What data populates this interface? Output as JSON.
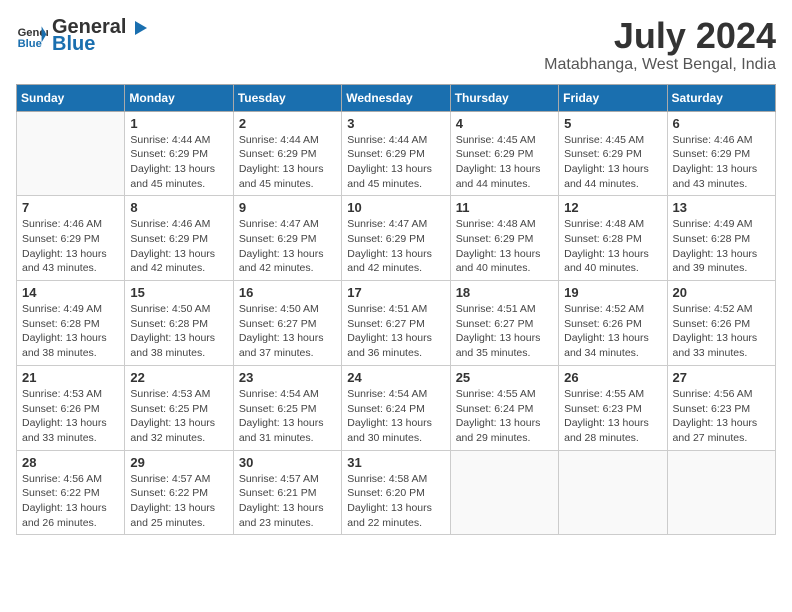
{
  "logo": {
    "text_general": "General",
    "text_blue": "Blue"
  },
  "title": "July 2024",
  "subtitle": "Matabhanga, West Bengal, India",
  "headers": [
    "Sunday",
    "Monday",
    "Tuesday",
    "Wednesday",
    "Thursday",
    "Friday",
    "Saturday"
  ],
  "weeks": [
    [
      {
        "day": "",
        "info": ""
      },
      {
        "day": "1",
        "info": "Sunrise: 4:44 AM\nSunset: 6:29 PM\nDaylight: 13 hours\nand 45 minutes."
      },
      {
        "day": "2",
        "info": "Sunrise: 4:44 AM\nSunset: 6:29 PM\nDaylight: 13 hours\nand 45 minutes."
      },
      {
        "day": "3",
        "info": "Sunrise: 4:44 AM\nSunset: 6:29 PM\nDaylight: 13 hours\nand 45 minutes."
      },
      {
        "day": "4",
        "info": "Sunrise: 4:45 AM\nSunset: 6:29 PM\nDaylight: 13 hours\nand 44 minutes."
      },
      {
        "day": "5",
        "info": "Sunrise: 4:45 AM\nSunset: 6:29 PM\nDaylight: 13 hours\nand 44 minutes."
      },
      {
        "day": "6",
        "info": "Sunrise: 4:46 AM\nSunset: 6:29 PM\nDaylight: 13 hours\nand 43 minutes."
      }
    ],
    [
      {
        "day": "7",
        "info": "Sunrise: 4:46 AM\nSunset: 6:29 PM\nDaylight: 13 hours\nand 43 minutes."
      },
      {
        "day": "8",
        "info": "Sunrise: 4:46 AM\nSunset: 6:29 PM\nDaylight: 13 hours\nand 42 minutes."
      },
      {
        "day": "9",
        "info": "Sunrise: 4:47 AM\nSunset: 6:29 PM\nDaylight: 13 hours\nand 42 minutes."
      },
      {
        "day": "10",
        "info": "Sunrise: 4:47 AM\nSunset: 6:29 PM\nDaylight: 13 hours\nand 42 minutes."
      },
      {
        "day": "11",
        "info": "Sunrise: 4:48 AM\nSunset: 6:29 PM\nDaylight: 13 hours\nand 40 minutes."
      },
      {
        "day": "12",
        "info": "Sunrise: 4:48 AM\nSunset: 6:28 PM\nDaylight: 13 hours\nand 40 minutes."
      },
      {
        "day": "13",
        "info": "Sunrise: 4:49 AM\nSunset: 6:28 PM\nDaylight: 13 hours\nand 39 minutes."
      }
    ],
    [
      {
        "day": "14",
        "info": "Sunrise: 4:49 AM\nSunset: 6:28 PM\nDaylight: 13 hours\nand 38 minutes."
      },
      {
        "day": "15",
        "info": "Sunrise: 4:50 AM\nSunset: 6:28 PM\nDaylight: 13 hours\nand 38 minutes."
      },
      {
        "day": "16",
        "info": "Sunrise: 4:50 AM\nSunset: 6:27 PM\nDaylight: 13 hours\nand 37 minutes."
      },
      {
        "day": "17",
        "info": "Sunrise: 4:51 AM\nSunset: 6:27 PM\nDaylight: 13 hours\nand 36 minutes."
      },
      {
        "day": "18",
        "info": "Sunrise: 4:51 AM\nSunset: 6:27 PM\nDaylight: 13 hours\nand 35 minutes."
      },
      {
        "day": "19",
        "info": "Sunrise: 4:52 AM\nSunset: 6:26 PM\nDaylight: 13 hours\nand 34 minutes."
      },
      {
        "day": "20",
        "info": "Sunrise: 4:52 AM\nSunset: 6:26 PM\nDaylight: 13 hours\nand 33 minutes."
      }
    ],
    [
      {
        "day": "21",
        "info": "Sunrise: 4:53 AM\nSunset: 6:26 PM\nDaylight: 13 hours\nand 33 minutes."
      },
      {
        "day": "22",
        "info": "Sunrise: 4:53 AM\nSunset: 6:25 PM\nDaylight: 13 hours\nand 32 minutes."
      },
      {
        "day": "23",
        "info": "Sunrise: 4:54 AM\nSunset: 6:25 PM\nDaylight: 13 hours\nand 31 minutes."
      },
      {
        "day": "24",
        "info": "Sunrise: 4:54 AM\nSunset: 6:24 PM\nDaylight: 13 hours\nand 30 minutes."
      },
      {
        "day": "25",
        "info": "Sunrise: 4:55 AM\nSunset: 6:24 PM\nDaylight: 13 hours\nand 29 minutes."
      },
      {
        "day": "26",
        "info": "Sunrise: 4:55 AM\nSunset: 6:23 PM\nDaylight: 13 hours\nand 28 minutes."
      },
      {
        "day": "27",
        "info": "Sunrise: 4:56 AM\nSunset: 6:23 PM\nDaylight: 13 hours\nand 27 minutes."
      }
    ],
    [
      {
        "day": "28",
        "info": "Sunrise: 4:56 AM\nSunset: 6:22 PM\nDaylight: 13 hours\nand 26 minutes."
      },
      {
        "day": "29",
        "info": "Sunrise: 4:57 AM\nSunset: 6:22 PM\nDaylight: 13 hours\nand 25 minutes."
      },
      {
        "day": "30",
        "info": "Sunrise: 4:57 AM\nSunset: 6:21 PM\nDaylight: 13 hours\nand 23 minutes."
      },
      {
        "day": "31",
        "info": "Sunrise: 4:58 AM\nSunset: 6:20 PM\nDaylight: 13 hours\nand 22 minutes."
      },
      {
        "day": "",
        "info": ""
      },
      {
        "day": "",
        "info": ""
      },
      {
        "day": "",
        "info": ""
      }
    ]
  ]
}
